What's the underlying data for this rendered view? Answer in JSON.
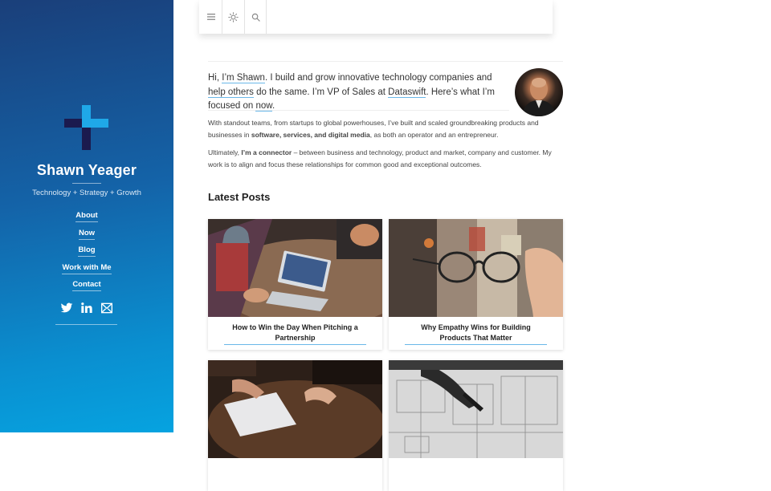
{
  "sidebar": {
    "site_name": "Shawn Yeager",
    "tagline": "Technology + Strategy + Growth",
    "nav": [
      "About",
      "Now",
      "Blog",
      "Work with Me",
      "Contact"
    ],
    "social_icons": [
      "twitter-icon",
      "linkedin-icon",
      "email-icon"
    ],
    "colors": {
      "gradient_top": "#1a3f7a",
      "gradient_bottom": "#06a3e0",
      "logo_light": "#1fa8e8",
      "logo_dark": "#1b1a4e"
    }
  },
  "toolbar": {
    "icons": [
      "menu-icon",
      "brightness-icon",
      "search-icon"
    ]
  },
  "intro": {
    "hi": "Hi, ",
    "im_shawn": "I’m Shawn",
    "t1": ". I build and grow innovative technology companies and ",
    "help_others": "help others",
    "t2": " do the same. I’m VP of Sales at ",
    "dataswift": "Dataswift",
    "t3": ". Here’s what I’m focused on ",
    "now": "now",
    "t4": "."
  },
  "para1": {
    "a": "With standout teams, from startups to global powerhouses, I’ve built and scaled groundbreaking products and businesses in ",
    "b": "software, services, and digital media",
    "c": ", as both an operator and an entrepreneur."
  },
  "para2": {
    "a": "Ultimately, ",
    "b": "I’m a connector",
    "c": " – between business and technology, product and market, company and customer. My work is to align and focus these relationships for common good and exceptional outcomes."
  },
  "latest_posts": {
    "heading": "Latest Posts",
    "posts": [
      {
        "title": "How to Win the Day When Pitching a Partnership"
      },
      {
        "title": "Why Empathy Wins for Building Products That Matter"
      },
      {
        "title": ""
      },
      {
        "title": ""
      }
    ]
  },
  "accent_color": "#6ab7e8"
}
